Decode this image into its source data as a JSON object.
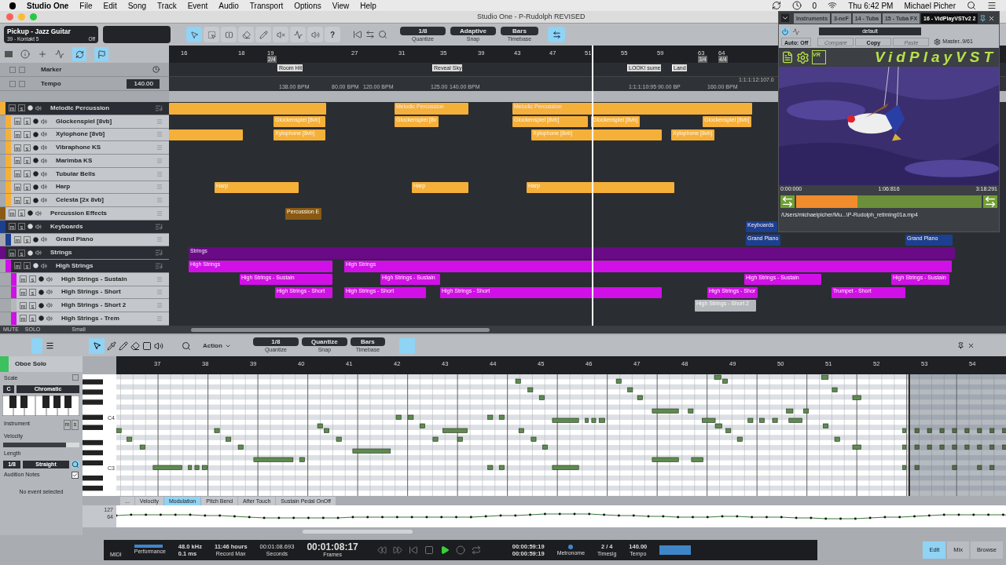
{
  "menu_bar": {
    "app": "Studio One",
    "menus": [
      "File",
      "Edit",
      "Song",
      "Track",
      "Event",
      "Audio",
      "Transport",
      "Options",
      "View",
      "Help"
    ],
    "eject_count": "0",
    "clock": "Thu 6:42 PM",
    "user": "Michael Picher"
  },
  "window": {
    "title": "Studio One - P-Rudolph REVISED"
  },
  "toolbar": {
    "instrument": "Pickup - Jazz Guitar",
    "instrument_sub": "39 - Kontakt 5",
    "instrument_state": "Off",
    "tools": [
      {
        "kind": "arrow",
        "selected": true
      },
      {
        "kind": "range",
        "selected": false
      },
      {
        "kind": "split",
        "selected": false
      },
      {
        "kind": "eraser",
        "selected": false
      },
      {
        "kind": "paint",
        "selected": false
      },
      {
        "kind": "mute",
        "selected": false
      },
      {
        "kind": "bend",
        "selected": false
      },
      {
        "kind": "listen",
        "selected": false
      }
    ],
    "help": "?",
    "quantize": {
      "value": "1/8",
      "label": "Quantize"
    },
    "snap": {
      "value": "Adaptive",
      "label": "Snap"
    },
    "timebase": {
      "value": "Bars",
      "label": "Timebase"
    }
  },
  "arrange": {
    "ruler": [
      "16",
      "18",
      "19",
      "27",
      "31",
      "35",
      "39",
      "43",
      "47",
      "51",
      "55",
      "59",
      "63",
      "64"
    ],
    "timesigs": [
      "2/4",
      "3/4",
      "4/4"
    ],
    "marker_track": {
      "name": "Marker",
      "markers": [
        "Room Hit",
        "Reveal Sky",
        "LOOK! sume",
        "Land"
      ]
    },
    "tempo_track": {
      "name": "Tempo",
      "value": "140.00",
      "changes": [
        "138.00 BPM",
        "80.00 BPM",
        "120.00 BPM",
        "125.00",
        "140.00 BPM",
        "1:1:1:10:95 90.00 BP",
        "160.00 BPM",
        "1:1:1:12:107.0"
      ]
    },
    "tracks": [
      {
        "name": "Melodic Percussion",
        "kind": "folder",
        "color": "#f5b03a",
        "mute": "m",
        "solo": "s",
        "clips": [
          {
            "kind": "plain"
          },
          {
            "kind": "labeled",
            "label": "Melodic Percussion"
          },
          {
            "kind": "labeled",
            "label": "Melodic Percussion"
          }
        ],
        "children": [
          {
            "name": "Glockenspiel [8vb]",
            "kind": "track",
            "color": "#f5b03a",
            "mute": "m",
            "solo": "s",
            "clips": [
              {
                "kind": "labeled",
                "label": "Glockenspiel [8vb]"
              },
              {
                "kind": "labeled",
                "label": "Glockenspiel [8v"
              },
              {
                "kind": "labeled",
                "label": "Glockenspiel [8vb]"
              },
              {
                "kind": "labeled",
                "label": "Glockenspiel [8vb]"
              },
              {
                "kind": "labeled",
                "label": "Glockenspiel [8vb]"
              }
            ]
          },
          {
            "name": "Xylophone [8vb]",
            "kind": "track",
            "color": "#f5b03a",
            "mute": "m",
            "solo": "s",
            "clips": [
              {
                "kind": "plain"
              },
              {
                "kind": "labeled",
                "label": "Xylophone [8vb]"
              },
              {
                "kind": "labeled",
                "label": "Xylophone [8vb]"
              },
              {
                "kind": "labeled",
                "label": "Xylophone [8vb]"
              }
            ]
          },
          {
            "name": "Vibraphone KS",
            "kind": "track",
            "color": "#f5b03a",
            "mute": "m",
            "solo": "s"
          },
          {
            "name": "Marimba KS",
            "kind": "track",
            "color": "#f5b03a",
            "mute": "m",
            "solo": "s"
          },
          {
            "name": "Tubular Bells",
            "kind": "track",
            "color": "#f5b03a",
            "mute": "m",
            "solo": "s"
          },
          {
            "name": "Harp",
            "kind": "track",
            "color": "#f5b03a",
            "mute": "m",
            "solo": "s",
            "clips": [
              {
                "kind": "labeled",
                "label": "Harp"
              },
              {
                "kind": "labeled",
                "label": "Harp"
              },
              {
                "kind": "labeled",
                "label": "Harp"
              }
            ]
          },
          {
            "name": "Celesta [2x 8vb]",
            "kind": "track",
            "color": "#f5b03a",
            "mute": "m",
            "solo": "s"
          }
        ]
      },
      {
        "name": "Percussion Effects",
        "kind": "track",
        "color": "#8a5a14",
        "mute": "m",
        "solo": "s",
        "clips": [
          {
            "kind": "labeled",
            "label": "Percussion E"
          }
        ]
      },
      {
        "name": "Keyboards",
        "kind": "folder",
        "color": "#1c3f8f",
        "mute": "m",
        "solo": "s",
        "clips": [
          {
            "kind": "labeled",
            "label": "Keyboards"
          }
        ],
        "children": [
          {
            "name": "Grand Piano",
            "kind": "track",
            "color": "#1c3f8f",
            "mute": "m",
            "solo": "s",
            "clips": [
              {
                "kind": "labeled",
                "label": "Grand Piano"
              },
              {
                "kind": "labeled",
                "label": "Grand Piano"
              }
            ]
          }
        ]
      },
      {
        "name": "Strings",
        "kind": "folder",
        "color": "#6a0a86",
        "mute": "m",
        "solo": "s",
        "clips": [
          {
            "kind": "labeled",
            "label": "Strings"
          }
        ],
        "children": [
          {
            "name": "High Strings",
            "kind": "folder",
            "color": "#d010e6",
            "mute": "m",
            "solo": "s",
            "clips": [
              {
                "kind": "labeled",
                "label": "High Strings"
              },
              {
                "kind": "labeled",
                "label": "High Strings"
              }
            ],
            "children": [
              {
                "name": "High Strings - Sustain",
                "kind": "track",
                "color": "#d010e6",
                "mute": "m",
                "solo": "s",
                "clips": [
                  {
                    "kind": "labeled",
                    "label": "High Strings - Sustain"
                  },
                  {
                    "kind": "labeled",
                    "label": "High Strings - Sustain"
                  },
                  {
                    "kind": "labeled",
                    "label": "High Strings - Sustain"
                  },
                  {
                    "kind": "labeled",
                    "label": "High Strings - Sustain"
                  }
                ]
              },
              {
                "name": "High Strings - Short",
                "kind": "track",
                "color": "#d010e6",
                "mute": "m",
                "solo": "s",
                "clips": [
                  {
                    "kind": "labeled",
                    "label": "High Strings - Short"
                  },
                  {
                    "kind": "labeled",
                    "label": "High Strings - Short"
                  },
                  {
                    "kind": "labeled",
                    "label": "High Strings - Short"
                  },
                  {
                    "kind": "labeled",
                    "label": "High Strings - Shor"
                  },
                  {
                    "kind": "labeled",
                    "label": "Trumpet - Short"
                  }
                ]
              },
              {
                "name": "High Strings - Short 2",
                "kind": "track",
                "color": "#b4b8bd",
                "mute": "m",
                "solo": "s",
                "clips": [
                  {
                    "kind": "labeled",
                    "label": "High Strings - Short 2"
                  }
                ]
              },
              {
                "name": "High Strings - Trem",
                "kind": "track",
                "color": "#d010e6",
                "mute": "m",
                "solo": "s"
              }
            ]
          }
        ]
      }
    ],
    "footer": {
      "mute": "MUTE",
      "solo": "SOLO",
      "size": "Small"
    }
  },
  "plugin": {
    "tabs": [
      {
        "label": "Instruments",
        "selected": false
      },
      {
        "label": "3-neF",
        "selected": false
      },
      {
        "label": "14 - Tuba",
        "selected": false
      },
      {
        "label": "15 - Tuba FX",
        "selected": false
      },
      {
        "label": "16 - VidPlayVSTv2 2",
        "selected": true
      }
    ],
    "preset": "default",
    "buttons": [
      {
        "label": "Auto: Off",
        "disabled": false
      },
      {
        "label": "Compare",
        "disabled": true
      },
      {
        "label": "Copy",
        "disabled": false
      },
      {
        "label": "Paste",
        "disabled": true
      }
    ],
    "routing": "Master..9/61",
    "logo": "VidPlayVST",
    "logo_badge": "VR",
    "times": [
      "0:00:000",
      "1:06:816",
      "3:18:291"
    ],
    "position": {
      "level": 0.33
    },
    "file": "/Users/michaelpicher/Mu...\\P-Rudolph_retiming01a.mp4"
  },
  "editor": {
    "action": "Action",
    "quantize": {
      "value": "1/8",
      "label": "Quantize"
    },
    "snap": {
      "value": "Quantize",
      "label": "Snap"
    },
    "timebase": {
      "value": "Bars",
      "label": "Timebase"
    },
    "inspector": {
      "track": "Oboe Solo",
      "color": "#3cc060",
      "scale_label": "Scale",
      "root": "C",
      "scale": "Chromatic",
      "instrument_label": "Instrument",
      "instrument_mute": "m",
      "instrument_solo": "s",
      "velocity_label": "Velocity",
      "velocity": {
        "level": 0.82
      },
      "length_label": "Length",
      "length": "1/8",
      "length_mode": "Straight",
      "audition": {
        "label": "Audition Notes",
        "checked": true
      },
      "status": "No event selected"
    },
    "ruler": [
      "37",
      "38",
      "39",
      "40",
      "41",
      "42",
      "43",
      "44",
      "45",
      "46",
      "47",
      "48",
      "49",
      "50",
      "51",
      "52",
      "53",
      "54"
    ],
    "octaves": [
      "C4",
      "C3"
    ],
    "lane_tabs": [
      {
        "label": "...",
        "selected": false
      },
      {
        "label": "Velocity",
        "selected": false
      },
      {
        "label": "Modulation",
        "selected": true
      },
      {
        "label": "Pitch Bend",
        "selected": false
      },
      {
        "label": "After Touch",
        "selected": false
      },
      {
        "label": "Sustain Pedal OnOff",
        "selected": false
      }
    ],
    "lane_scale": [
      "127",
      "64"
    ]
  },
  "transport": {
    "midi": "MIDI",
    "performance": "Performance",
    "rate": "48.0 kHz",
    "latency": "0.1 ms",
    "record_time": "11:46 hours",
    "record_label": "Record Max",
    "seconds": "00:01:08.693",
    "seconds_label": "Seconds",
    "frames": "00:01:08:17",
    "frames_label": "Frames",
    "playing": true,
    "loop_start": "00:00:59:19",
    "loop_end": "00:00:59:19",
    "metronome": "Metronome",
    "timesig": "2 / 4",
    "timesig_label": "Timesig",
    "tempo": "140.00",
    "tempo_label": "Tempo"
  },
  "views": [
    {
      "label": "Edit",
      "selected": true
    },
    {
      "label": "Mix",
      "selected": false
    },
    {
      "label": "Browse",
      "selected": false
    }
  ]
}
